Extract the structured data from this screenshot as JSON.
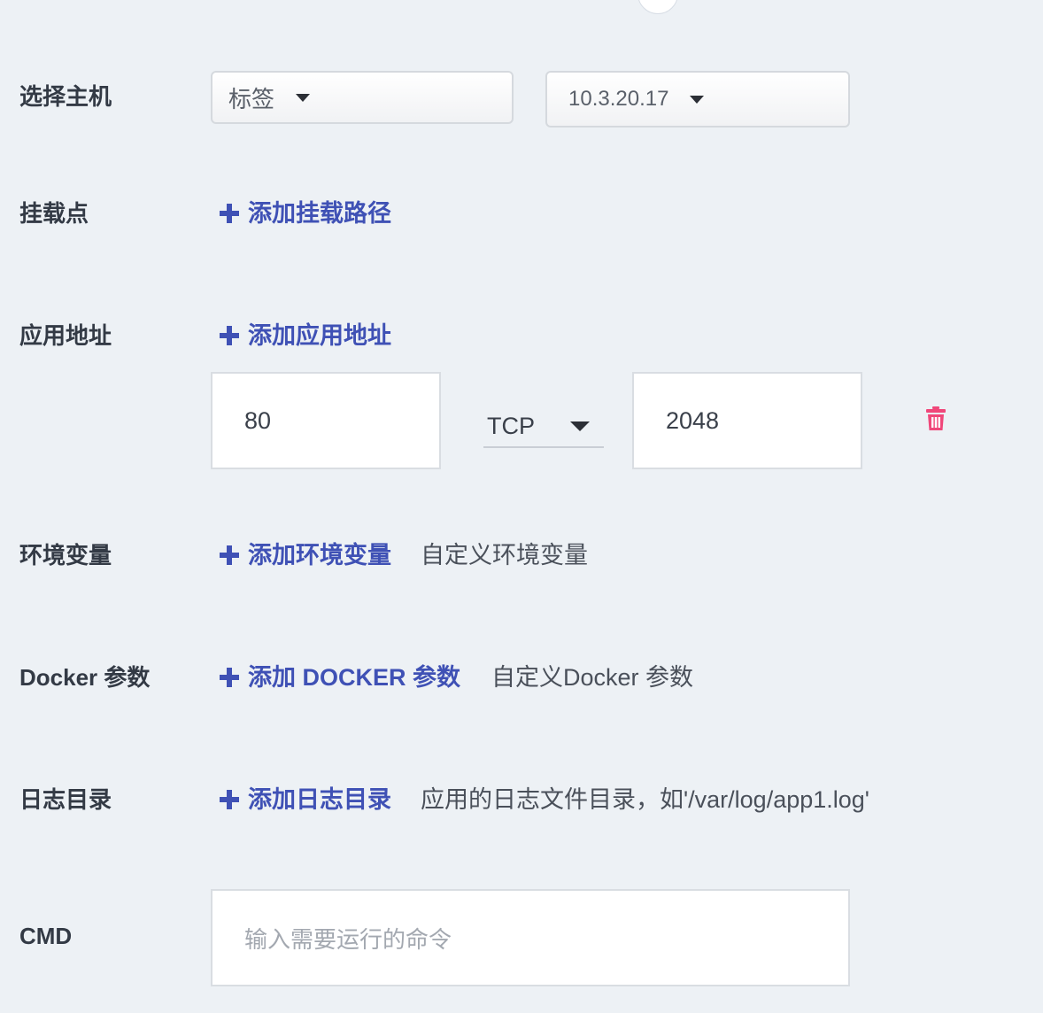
{
  "host": {
    "label": "选择主机",
    "tag_select": "标签",
    "ip_select": "10.3.20.17"
  },
  "mount": {
    "label": "挂载点",
    "add_label": "添加挂载路径"
  },
  "app_address": {
    "label": "应用地址",
    "add_label": "添加应用地址",
    "entry": {
      "container_port": "80",
      "protocol": "TCP",
      "host_port": "2048"
    }
  },
  "env": {
    "label": "环境变量",
    "add_label": "添加环境变量",
    "hint": "自定义环境变量"
  },
  "docker": {
    "label": "Docker 参数",
    "add_label": "添加 DOCKER 参数",
    "hint": "自定义Docker 参数"
  },
  "log": {
    "label": "日志目录",
    "add_label": "添加日志目录",
    "hint": "应用的日志文件目录，如'/var/log/app1.log'"
  },
  "cmd": {
    "label": "CMD",
    "placeholder": "输入需要运行的命令"
  },
  "colors": {
    "accent": "#3f51b5",
    "danger": "#f0477a",
    "background": "#edf1f5"
  }
}
